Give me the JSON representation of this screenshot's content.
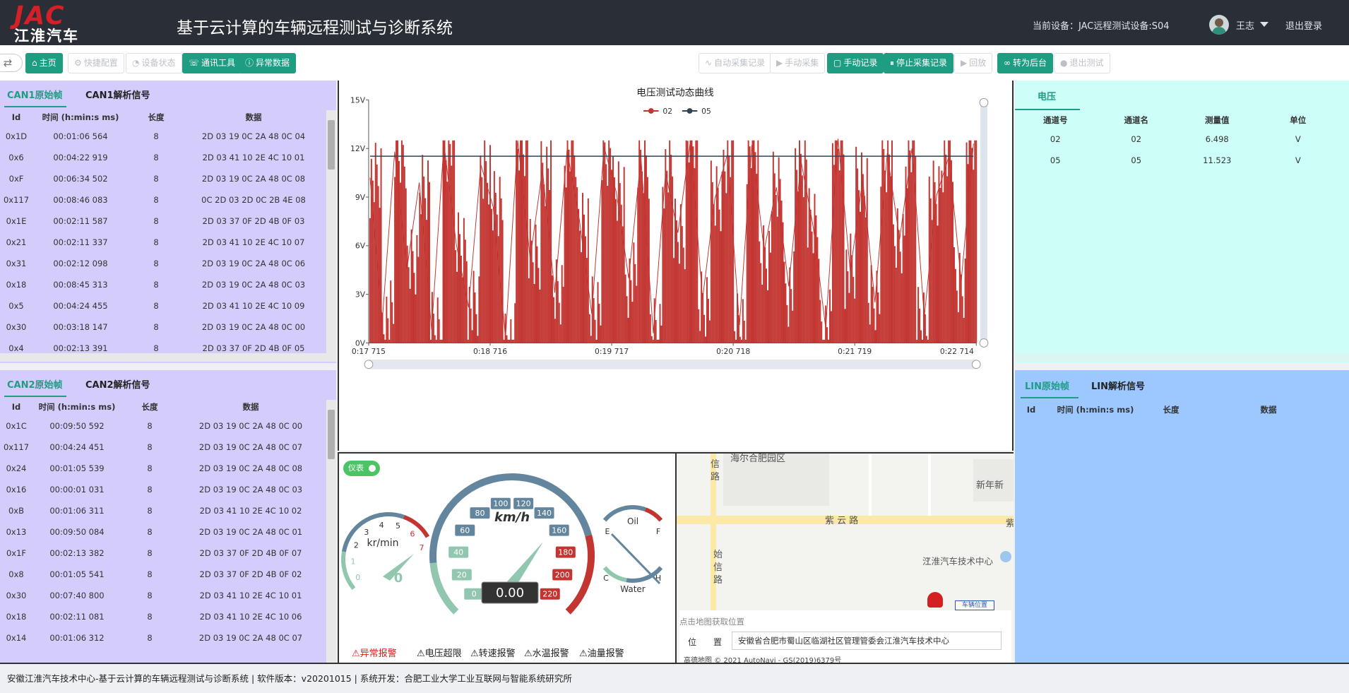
{
  "header": {
    "logo_top": "JAC",
    "logo_bottom": "江淮汽车",
    "title": "基于云计算的车辆远程测试与诊断系统",
    "current_device": "当前设备：JAC远程测试设备:S04",
    "user_name": "王志",
    "logout": "退出登录"
  },
  "toolbar": {
    "collapse_icon": "⇄",
    "left_buttons": [
      {
        "label": "主页",
        "icon": "⌂",
        "enabled": true
      },
      {
        "label": "快捷配置",
        "icon": "⚙",
        "enabled": false
      },
      {
        "label": "设备状态",
        "icon": "◔",
        "enabled": false
      },
      {
        "label": "通讯工具",
        "icon": "☏",
        "enabled": true
      },
      {
        "label": "异常数据",
        "icon": "ⓘ",
        "enabled": true
      }
    ],
    "right_buttons": [
      {
        "label": "自动采集记录",
        "icon": "∿",
        "enabled": false
      },
      {
        "label": "手动采集",
        "icon": "▶",
        "enabled": false
      },
      {
        "label": "手动记录",
        "icon": "▢",
        "enabled": true
      },
      {
        "label": "停止采集记录",
        "icon": "⏸",
        "enabled": true
      },
      {
        "label": "回放",
        "icon": "▶",
        "enabled": false
      },
      {
        "label": "转为后台",
        "icon": "∞",
        "enabled": true
      },
      {
        "label": "退出测试",
        "icon": "●",
        "enabled": false
      }
    ]
  },
  "can1": {
    "tabs": [
      "CAN1原始帧",
      "CAN1解析信号"
    ],
    "columns": [
      "Id",
      "时间 (h:min:s ms)",
      "长度",
      "数据"
    ],
    "rows": [
      [
        "0x1D",
        "00:01:06 564",
        "8",
        "2D 03 19 0C 2A 48 0C 04"
      ],
      [
        "0x6",
        "00:04:22 919",
        "8",
        "2D 03 41 10 2E 4C 10 01"
      ],
      [
        "0xF",
        "00:06:34 502",
        "8",
        "2D 03 19 0C 2A 48 0C 08"
      ],
      [
        "0x117",
        "00:08:46 083",
        "8",
        "0C 2D 03 2D 0C 2B 4E 08"
      ],
      [
        "0x1E",
        "00:02:11 587",
        "8",
        "2D 03 37 0F 2D 4B 0F 03"
      ],
      [
        "0x21",
        "00:02:11 337",
        "8",
        "2D 03 41 10 2E 4C 10 07"
      ],
      [
        "0x31",
        "00:02:12 098",
        "8",
        "2D 03 19 0C 2A 48 0C 06"
      ],
      [
        "0x18",
        "00:08:45 313",
        "8",
        "2D 03 19 0C 2A 48 0C 03"
      ],
      [
        "0x5",
        "00:04:24 455",
        "8",
        "2D 03 41 10 2E 4C 10 09"
      ],
      [
        "0x30",
        "00:03:18 147",
        "8",
        "2D 03 19 0C 2A 48 0C 00"
      ],
      [
        "0x4",
        "00:02:13 391",
        "8",
        "2D 03 37 0F 2D 4B 0F 05"
      ]
    ]
  },
  "can2": {
    "tabs": [
      "CAN2原始帧",
      "CAN2解析信号"
    ],
    "columns": [
      "Id",
      "时间 (h:min:s ms)",
      "长度",
      "数据"
    ],
    "rows": [
      [
        "0x1C",
        "00:09:50 592",
        "8",
        "2D 03 19 0C 2A 48 0C 00"
      ],
      [
        "0x117",
        "00:04:24 451",
        "8",
        "2D 03 19 0C 2A 48 0C 07"
      ],
      [
        "0x24",
        "00:01:05 539",
        "8",
        "2D 03 19 0C 2A 48 0C 08"
      ],
      [
        "0x16",
        "00:00:01 031",
        "8",
        "2D 03 19 0C 2A 48 0C 03"
      ],
      [
        "0xB",
        "00:01:06 311",
        "8",
        "2D 03 41 10 2E 4C 10 02"
      ],
      [
        "0x13",
        "00:09:50 084",
        "8",
        "2D 03 19 0C 2A 48 0C 01"
      ],
      [
        "0x1F",
        "00:02:13 382",
        "8",
        "2D 03 37 0F 2D 4B 0F 07"
      ],
      [
        "0x8",
        "00:01:05 541",
        "8",
        "2D 03 37 0F 2D 4B 0F 02"
      ],
      [
        "0x30",
        "00:07:40 800",
        "8",
        "2D 03 41 10 2E 4C 10 01"
      ],
      [
        "0x18",
        "00:02:11 081",
        "8",
        "2D 03 41 10 2E 4C 10 06"
      ],
      [
        "0x14",
        "00:01:06 312",
        "8",
        "2D 03 19 0C 2A 48 0C 07"
      ]
    ]
  },
  "chart_data": {
    "type": "line",
    "title": "电压测试动态曲线",
    "series": [
      {
        "name": "02",
        "color": "#c23531",
        "values": [
          10.2,
          1.4,
          11.8,
          4.6,
          9.9,
          0.8,
          12.3,
          6.1,
          2.2,
          11.0,
          8.4,
          0.3,
          12.5,
          5.2,
          10.7,
          3.1,
          11.9,
          7.6,
          1.8,
          12.1,
          9.3,
          4.0,
          11.4,
          0.6,
          10.5,
          6.8,
          12.4,
          2.7,
          8.9,
          11.6,
          1.1,
          12.2,
          5.7,
          9.6,
          3.5,
          11.2,
          7.1,
          0.9,
          12.6,
          4.4,
          10.1,
          2.5,
          11.7,
          6.4,
          12.0,
          1.6,
          9.1,
          11.5,
          3.8,
          12.3
        ]
      },
      {
        "name": "05",
        "color": "#2f4554",
        "values": [
          11.523,
          11.523,
          11.523,
          11.523,
          11.523,
          11.523,
          11.523,
          11.523,
          11.523,
          11.523,
          11.523,
          11.523,
          11.523,
          11.523,
          11.523,
          11.523,
          11.523,
          11.523,
          11.523,
          11.523,
          11.523,
          11.523,
          11.523,
          11.523,
          11.523,
          11.523,
          11.523,
          11.523,
          11.523,
          11.523,
          11.523,
          11.523,
          11.523,
          11.523,
          11.523,
          11.523,
          11.523,
          11.523,
          11.523,
          11.523,
          11.523,
          11.523,
          11.523,
          11.523,
          11.523,
          11.523,
          11.523,
          11.523,
          11.523,
          11.523
        ]
      }
    ],
    "x_ticks": [
      "0:17 715",
      "0:18 716",
      "0:19 717",
      "0:20 718",
      "0:21 719",
      "0:22 714"
    ],
    "y_ticks": [
      "0V",
      "3V",
      "6V",
      "9V",
      "12V",
      "15V"
    ],
    "ylim": [
      0,
      15
    ],
    "legend_position": "top-center",
    "grid": false
  },
  "gauges": {
    "toggle_label": "仪表",
    "speed_unit": "km/h",
    "speed_value": "0.00",
    "speed_ticks": [
      "0",
      "20",
      "40",
      "60",
      "80",
      "100",
      "120",
      "140",
      "160",
      "180",
      "200",
      "220"
    ],
    "rpm_unit": "kr/min",
    "rpm_value": "0",
    "rpm_ticks": [
      "0",
      "1",
      "2",
      "3",
      "4",
      "5",
      "6",
      "7"
    ],
    "oil_label": "Oil",
    "water_label": "Water",
    "oil_marks": [
      "E",
      "F"
    ],
    "water_marks": [
      "C",
      "H"
    ],
    "alarms": [
      {
        "label": "异常报警",
        "active": true
      },
      {
        "label": "电压超限",
        "active": false
      },
      {
        "label": "转速报警",
        "active": false
      },
      {
        "label": "水温报警",
        "active": false
      },
      {
        "label": "油量报警",
        "active": false
      }
    ]
  },
  "map": {
    "labels": [
      "海尔合肥园区",
      "信",
      "路",
      "新年新",
      "紫 云 路",
      "紫",
      "始",
      "信",
      "路",
      "江淮汽车技术中心",
      "车辆位置"
    ],
    "hint": "点击地图获取位置",
    "address_label": "位　　置",
    "address_value": "安徽省合肥市蜀山区临湖社区管理管委会江淮汽车技术中心",
    "copyright": "高德地图 © 2021 AutoNavi - GS(2019)6379号"
  },
  "voltage": {
    "tab": "电压",
    "columns": [
      "通道号",
      "通道名",
      "测量值",
      "单位"
    ],
    "rows": [
      [
        "02",
        "02",
        "6.498",
        "V"
      ],
      [
        "05",
        "05",
        "11.523",
        "V"
      ]
    ]
  },
  "lin": {
    "tabs": [
      "LIN原始帧",
      "LIN解析信号"
    ],
    "columns": [
      "Id",
      "时间 (h:min:s ms)",
      "长度",
      "数据"
    ]
  },
  "footer": {
    "text": "安徽江淮汽车技术中心-基于云计算的车辆远程测试与诊断系统 | 软件版本：v20201015 | 系统开发：合肥工业大学工业互联网与智能系统研究所"
  }
}
